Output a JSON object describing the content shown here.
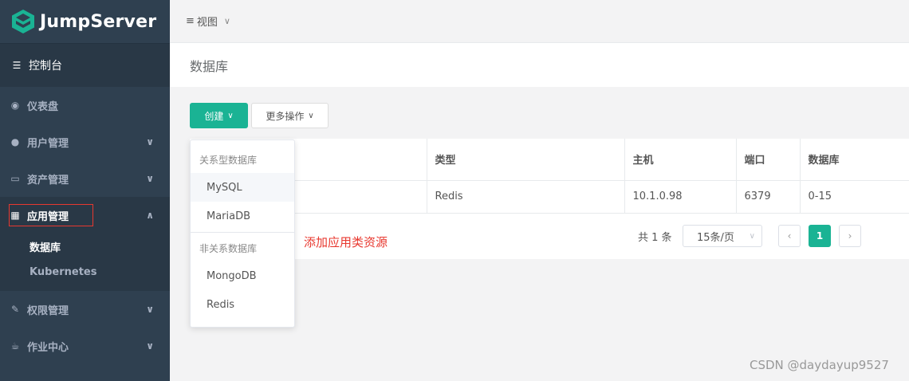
{
  "app": {
    "logo_text": "JumpServer"
  },
  "sidebar": {
    "console_label": "控制台",
    "items": [
      {
        "label": "仪表盘"
      },
      {
        "label": "用户管理"
      },
      {
        "label": "资产管理"
      },
      {
        "label": "应用管理"
      },
      {
        "label": "权限管理"
      },
      {
        "label": "作业中心"
      }
    ],
    "sub_items": [
      {
        "label": "数据库"
      },
      {
        "label": "Kubernetes"
      }
    ]
  },
  "topbar": {
    "view_label": "视图"
  },
  "page": {
    "title": "数据库"
  },
  "toolbar": {
    "create_label": "创建",
    "more_label": "更多操作"
  },
  "table": {
    "headers": [
      "类型",
      "主机",
      "端口",
      "数据库"
    ],
    "rows": [
      {
        "type": "Redis",
        "host": "10.1.0.98",
        "port": "6379",
        "db": "0-15"
      }
    ]
  },
  "dropdown": {
    "group1_label": "关系型数据库",
    "group1_items": [
      "MySQL",
      "MariaDB"
    ],
    "group2_label": "非关系数据库",
    "group2_items": [
      "MongoDB",
      "Redis"
    ]
  },
  "pagination": {
    "total": "共 1 条",
    "page_size": "15条/页",
    "current_page": "1"
  },
  "annotation": "添加应用类资源",
  "watermark": "CSDN @daydayup9527",
  "colors": {
    "sidebar_bg": "#2f4050",
    "accent": "#1ab394",
    "highlight_red": "#e8382f"
  }
}
